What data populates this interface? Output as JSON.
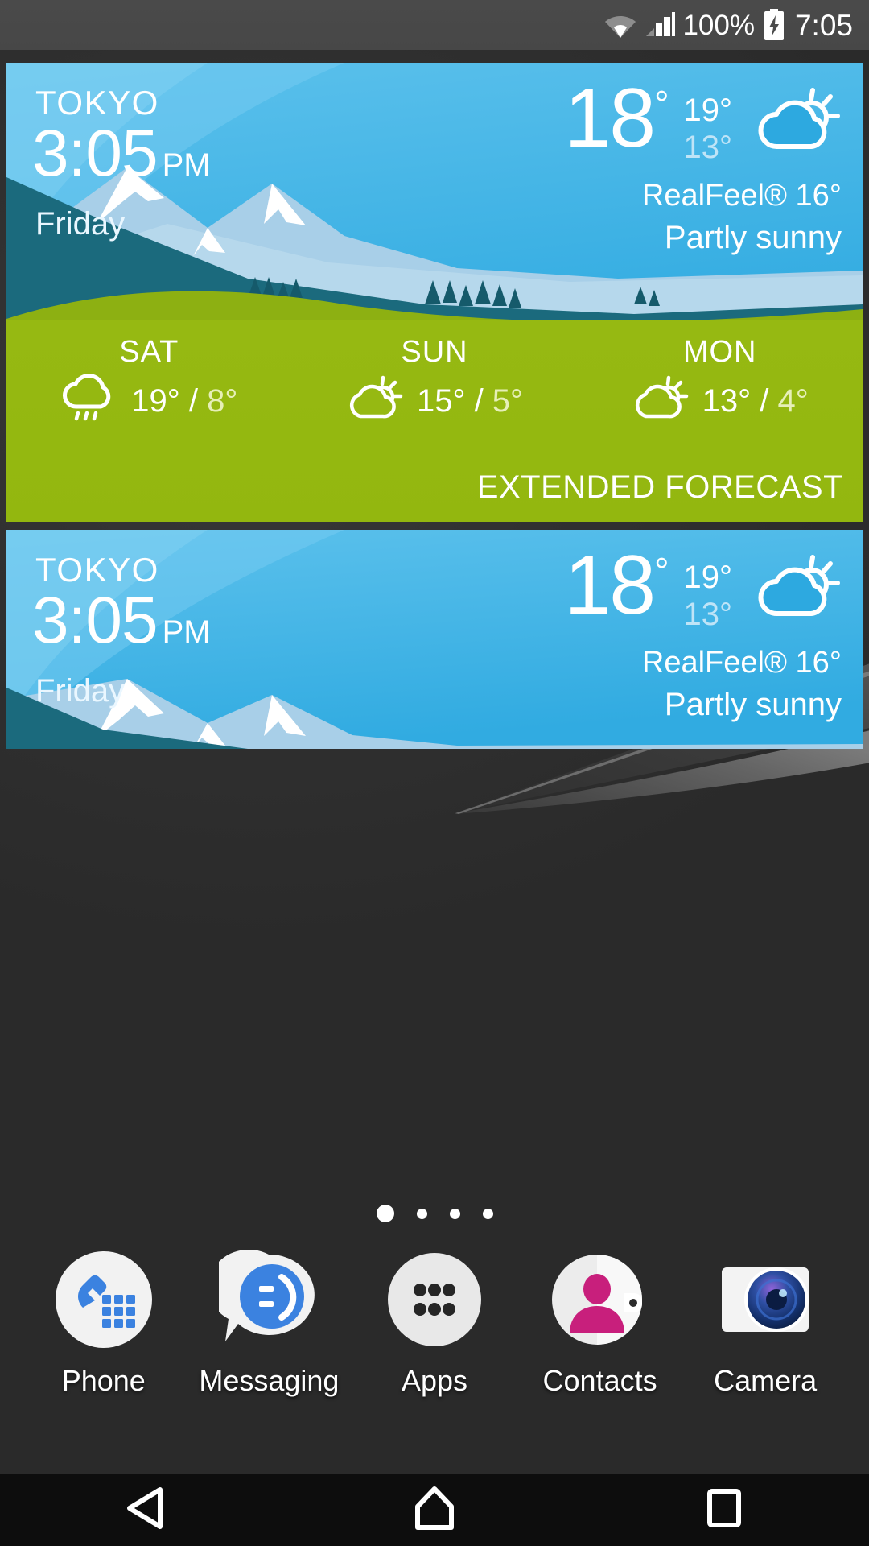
{
  "statusbar": {
    "battery_percent": "100%",
    "clock": "7:05",
    "icons": [
      "wifi-icon",
      "cellular-signal-icon",
      "battery-charging-icon"
    ]
  },
  "weather_widget": {
    "city": "TOKYO",
    "time": "3:05",
    "ampm": "PM",
    "day": "Friday",
    "current_temp": "18",
    "degree": "°",
    "high": "19°",
    "low": "13°",
    "realfeel": "RealFeel® 16°",
    "condition": "Partly sunny",
    "condition_icon": "partly-sunny-icon",
    "extended_label": "EXTENDED FORECAST",
    "forecast": [
      {
        "day": "SAT",
        "icon": "rain-icon",
        "high": "19°",
        "sep": " / ",
        "low": "8°"
      },
      {
        "day": "SUN",
        "icon": "partly-sunny-icon",
        "high": "15°",
        "sep": " / ",
        "low": "5°"
      },
      {
        "day": "MON",
        "icon": "partly-sunny-icon",
        "high": "13°",
        "sep": " / ",
        "low": "4°"
      }
    ],
    "colors": {
      "sky": "#37b0e4",
      "grass": "#96b912",
      "ridge": "#1b6a7d",
      "mountain": "#a8cfe8",
      "snow": "#ffffff"
    }
  },
  "weather_widget_small": {
    "city": "TOKYO",
    "time": "3:05",
    "ampm": "PM",
    "day": "Friday",
    "current_temp": "18",
    "degree": "°",
    "high": "19°",
    "low": "13°",
    "realfeel": "RealFeel® 16°",
    "condition": "Partly sunny",
    "condition_icon": "partly-sunny-icon"
  },
  "page_indicator": {
    "total": 4,
    "active_index": 0
  },
  "dock": {
    "items": [
      {
        "label": "Phone",
        "icon": "phone-icon"
      },
      {
        "label": "Messaging",
        "icon": "messaging-icon"
      },
      {
        "label": "Apps",
        "icon": "apps-grid-icon"
      },
      {
        "label": "Contacts",
        "icon": "contacts-icon"
      },
      {
        "label": "Camera",
        "icon": "camera-icon"
      }
    ]
  },
  "navbar": {
    "buttons": [
      {
        "name": "back",
        "icon": "back-triangle-icon"
      },
      {
        "name": "home",
        "icon": "home-pentagon-icon"
      },
      {
        "name": "recents",
        "icon": "recents-square-icon"
      }
    ]
  }
}
